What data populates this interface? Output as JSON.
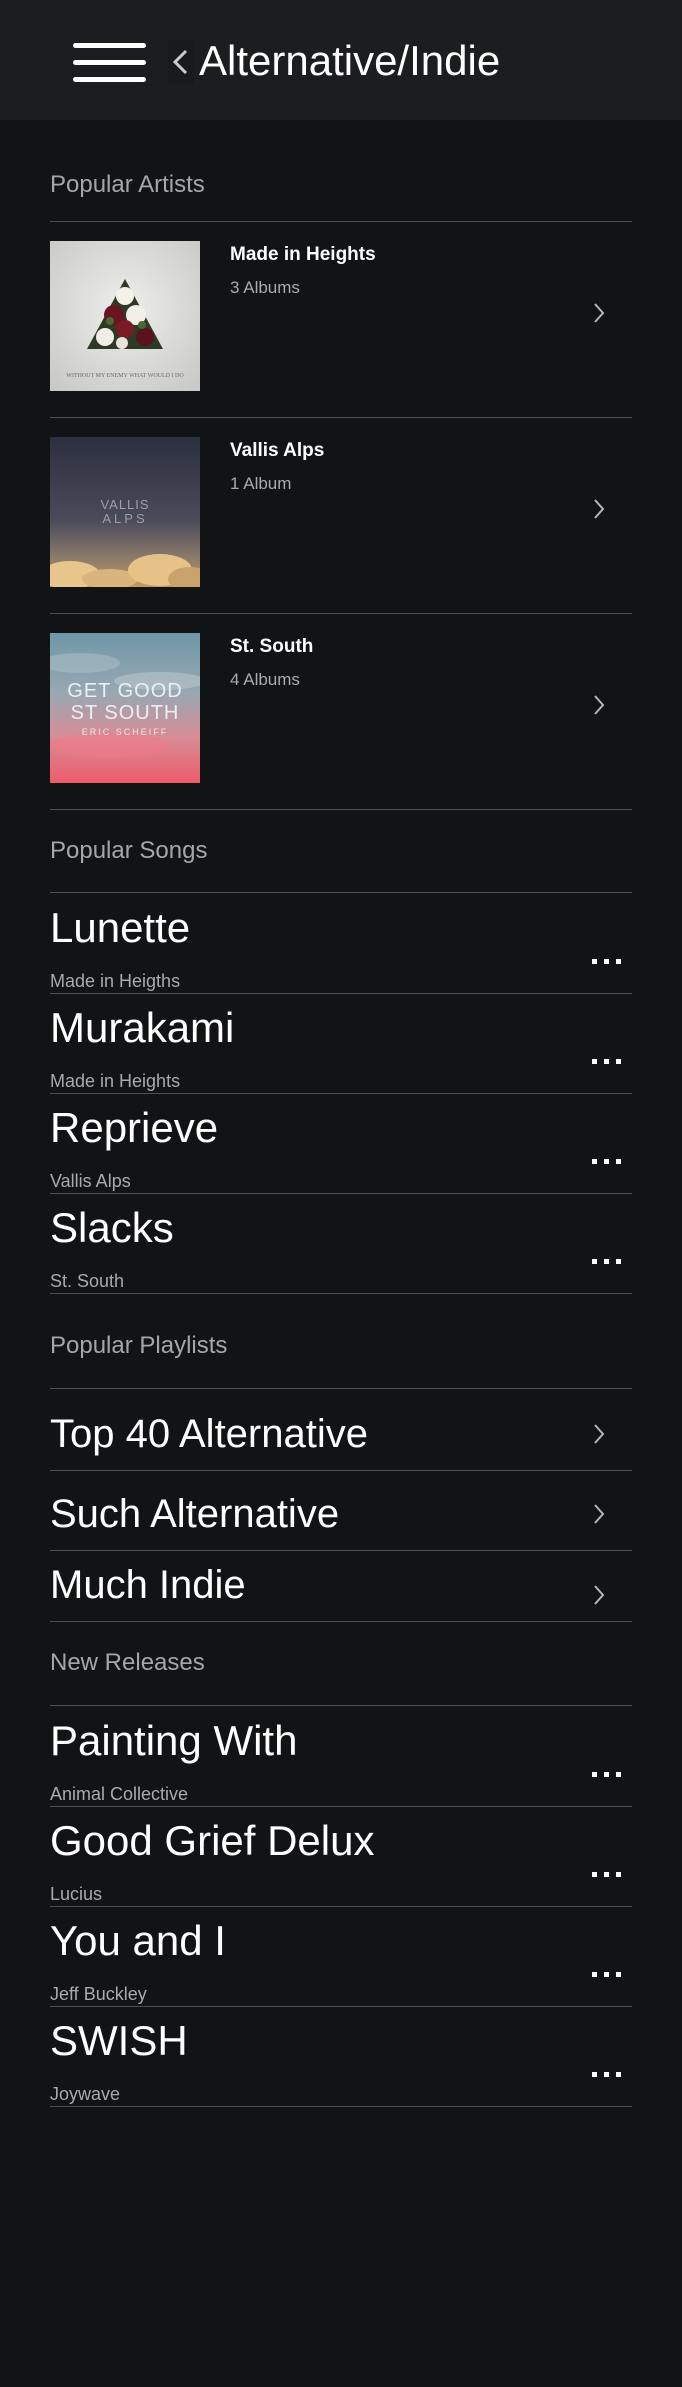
{
  "header": {
    "menu_icon": "hamburger-menu-icon",
    "back_icon": "chevron-left-icon",
    "title": "Alternative/Indie"
  },
  "popular_artists": {
    "heading": "Popular Artists",
    "items": [
      {
        "name": "Made in Heights",
        "count": "3 Albums",
        "art_icon": "album-art-flower-triangle",
        "art_text": "WITHOUT MY ENEMY WHAT WOULD I DO"
      },
      {
        "name": "Vallis Alps",
        "count": "1 Album",
        "art_icon": "album-art-clouds-sunset",
        "art_text_1": "VALLIS",
        "art_text_2": "ALPS"
      },
      {
        "name": "St. South",
        "count": "4 Albums",
        "art_icon": "album-art-pink-clouds",
        "art_text_1": "GET GOOD",
        "art_text_2": "ST SOUTH",
        "art_text_3": "ERIC SCHEIFF"
      }
    ]
  },
  "popular_songs": {
    "heading": "Popular Songs",
    "items": [
      {
        "title": "Lunette",
        "artist": "Made in Heigths"
      },
      {
        "title": "Murakami",
        "artist": "Made in Heights"
      },
      {
        "title": "Reprieve",
        "artist": "Vallis Alps"
      },
      {
        "title": "Slacks",
        "artist": "St. South"
      }
    ]
  },
  "popular_playlists": {
    "heading": "Popular Playlists",
    "items": [
      {
        "title": "Top 40 Alternative"
      },
      {
        "title": "Such Alternative"
      },
      {
        "title": "Much Indie"
      }
    ]
  },
  "new_releases": {
    "heading": "New Releases",
    "items": [
      {
        "title": "Painting With",
        "artist": "Animal Collective"
      },
      {
        "title": "Good Grief Delux",
        "artist": "Lucius"
      },
      {
        "title": "You and I",
        "artist": "Jeff Buckley"
      },
      {
        "title": "SWISH",
        "artist": "Joywave"
      }
    ]
  },
  "icons": {
    "row_more": "more-horizontal-icon",
    "row_chevron": "chevron-right-icon"
  },
  "colors": {
    "background": "#121315",
    "header": "#1c1d1e",
    "divider": "#4c4e51",
    "secondary_text": "#a8aaac"
  }
}
